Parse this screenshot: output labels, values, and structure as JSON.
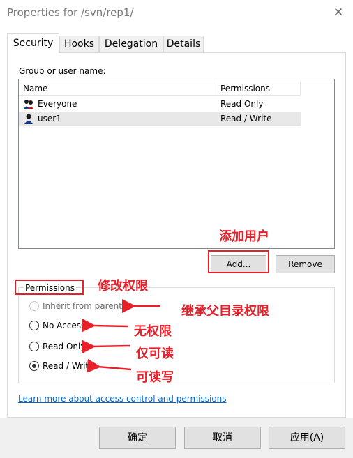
{
  "window": {
    "title": "Properties for /svn/rep1/"
  },
  "tabs": [
    {
      "label": "Security"
    },
    {
      "label": "Hooks"
    },
    {
      "label": "Delegation"
    },
    {
      "label": "Details"
    }
  ],
  "security": {
    "group_label": "Group or user name:",
    "columns": {
      "name": "Name",
      "permissions": "Permissions"
    },
    "rows": [
      {
        "name": "Everyone",
        "permissions": "Read Only",
        "icon": "group-icon",
        "selected": false
      },
      {
        "name": "user1",
        "permissions": "Read / Write",
        "icon": "user-icon",
        "selected": true
      }
    ],
    "add_button": "Add...",
    "remove_button": "Remove",
    "permissions_group": "Permissions",
    "options": [
      {
        "label": "Inherit from parent",
        "checked": false,
        "disabled": true
      },
      {
        "label": "No Access",
        "checked": false,
        "disabled": false
      },
      {
        "label": "Read Only",
        "checked": false,
        "disabled": false
      },
      {
        "label": "Read / Write",
        "checked": true,
        "disabled": false
      }
    ],
    "learn_more_link": "Learn more about access control and permissions"
  },
  "buttons": {
    "ok": "确定",
    "cancel": "取消",
    "apply": "应用(A)"
  },
  "annotations": {
    "add_user": "添加用户",
    "modify_permissions": "修改权限",
    "inherit": "继承父目录权限",
    "no_access": "无权限",
    "read_only": "仅可读",
    "read_write": "可读写"
  },
  "colors": {
    "annotation": "#e8202a",
    "link": "#0066cc"
  }
}
